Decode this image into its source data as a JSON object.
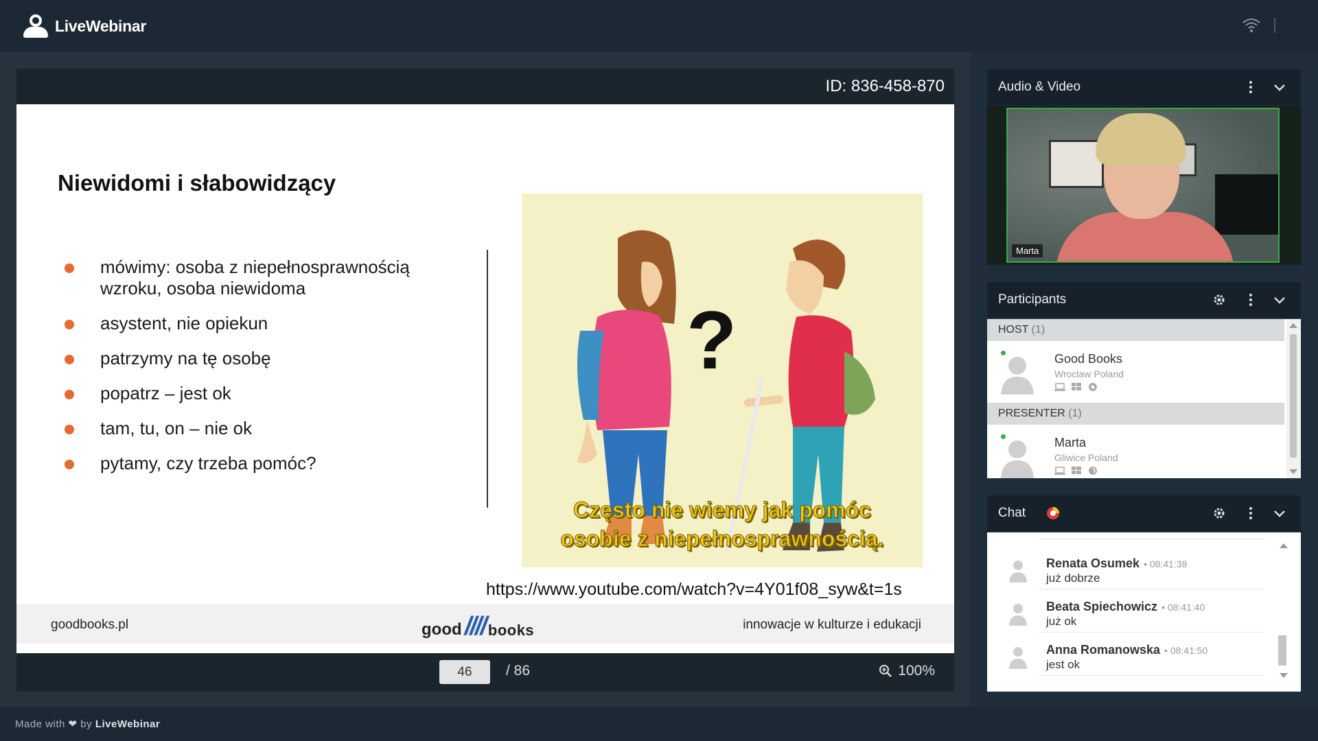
{
  "app": {
    "name": "LiveWebinar"
  },
  "presentation": {
    "meeting_id": "ID: 836-458-870",
    "slide": {
      "title": "Niewidomi i słabowidzący",
      "bullets": [
        "mówimy:   osoba   z niepełnosprawnością wzroku,   osoba   niewidoma",
        "asystent, nie opiekun",
        "patrzymy na tę osobę",
        "popatrz – jest ok",
        "tam, tu, on – nie ok",
        "pytamy, czy trzeba pomóc?"
      ],
      "image_caption_line1": "Często nie wiemy jak pomóc",
      "image_caption_line2": "osobie z niepełnosprawnością.",
      "illustration_mark": "?",
      "url": "https://www.youtube.com/watch?v=4Y01f08_syw&t=1s",
      "footer_left": "goodbooks.pl",
      "footer_logo_good": "good",
      "footer_logo_bars": "////",
      "footer_logo_books": "books",
      "footer_right": "innowacje w kulturze i edukacji",
      "bullet_color": "#e8692f"
    },
    "controls": {
      "current_page": "46",
      "total_pages": "/ 86",
      "zoom": "100%"
    }
  },
  "panels": {
    "audio_video": {
      "title": "Audio & Video",
      "video_label": "Marta"
    },
    "participants": {
      "title": "Participants",
      "groups": [
        {
          "label": "HOST",
          "count": "(1)",
          "people": [
            {
              "name": "Good Books",
              "location": "Wroclaw Poland"
            }
          ]
        },
        {
          "label": "PRESENTER",
          "count": "(1)",
          "people": [
            {
              "name": "Marta",
              "location": "Gliwice Poland"
            }
          ]
        }
      ]
    },
    "chat": {
      "title": "Chat",
      "messages": [
        {
          "name": "Renata Osumek",
          "time": "• 08:41:38",
          "text": "już dobrze"
        },
        {
          "name": "Beata Spiechowicz",
          "time": "• 08:41:40",
          "text": "już ok"
        },
        {
          "name": "Anna Romanowska",
          "time": "• 08:41:50",
          "text": "jest ok"
        }
      ]
    }
  },
  "footer": {
    "made_with": "Made with",
    "by": "by",
    "brand": "LiveWebinar"
  },
  "colors": {
    "background": "#1f2d3b",
    "panel_header": "#17212b",
    "online_dot": "#32b34a",
    "video_border": "#3ca845",
    "caption": "#f5c61c"
  }
}
